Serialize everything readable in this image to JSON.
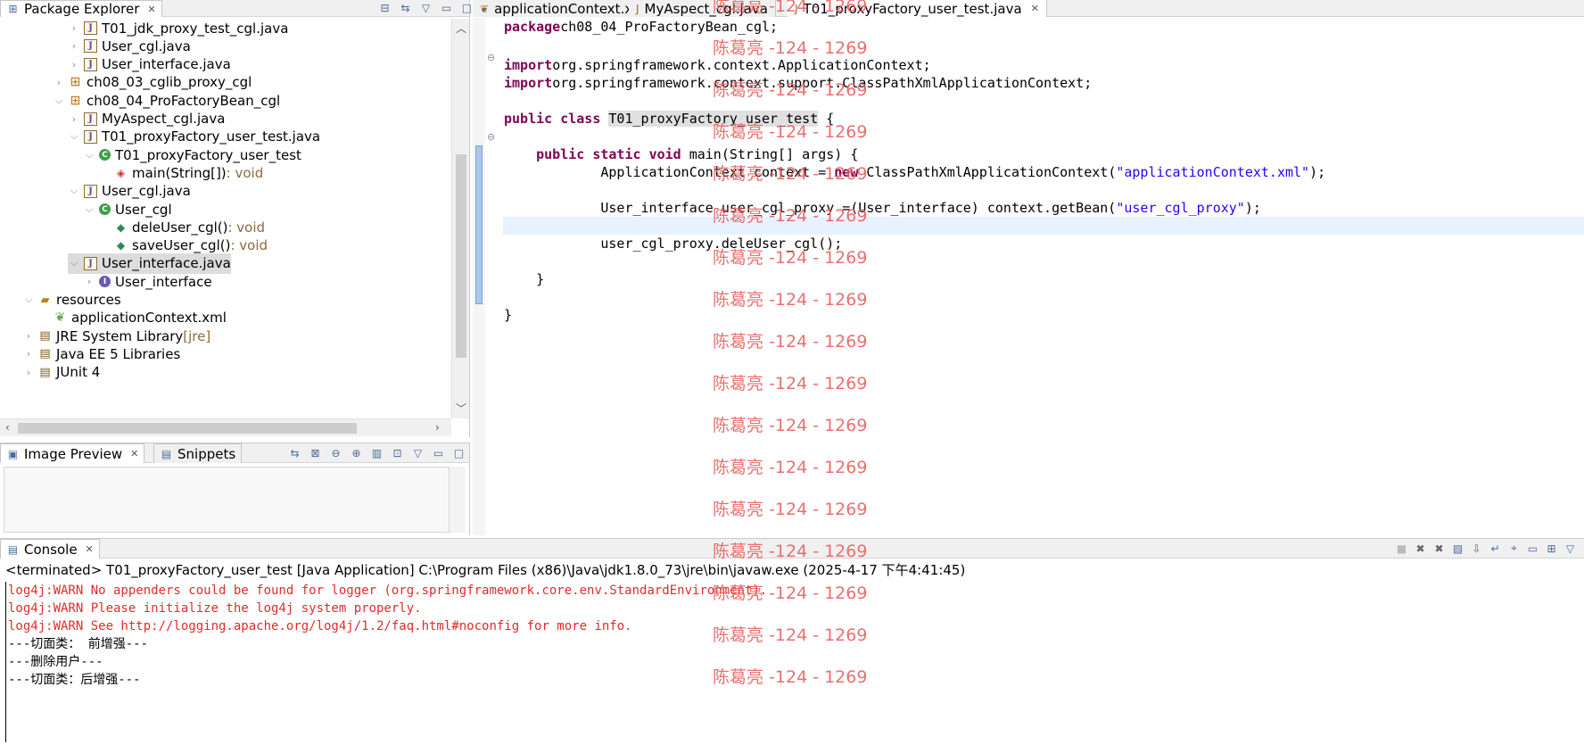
{
  "package_explorer": {
    "title": "Package Explorer",
    "tree": [
      {
        "label": "T01_jdk_proxy_test_cgl.java",
        "icon": "java-file-icon",
        "twisty": "collapsed",
        "indent": 4
      },
      {
        "label": "User_cgl.java",
        "icon": "java-file-icon",
        "twisty": "collapsed",
        "indent": 4
      },
      {
        "label": "User_interface.java",
        "icon": "java-file-icon",
        "twisty": "collapsed",
        "indent": 4
      },
      {
        "label": "ch08_03_cglib_proxy_cgl",
        "icon": "package-icon",
        "twisty": "collapsed",
        "indent": 3
      },
      {
        "label": "ch08_04_ProFactoryBean_cgl",
        "icon": "package-icon",
        "twisty": "expanded",
        "indent": 3
      },
      {
        "label": "MyAspect_cgl.java",
        "icon": "java-file-icon",
        "twisty": "collapsed",
        "indent": 4
      },
      {
        "label": "T01_proxyFactory_user_test.java",
        "icon": "java-file-icon",
        "twisty": "expanded",
        "indent": 4
      },
      {
        "label": "T01_proxyFactory_user_test",
        "icon": "class-icon",
        "twisty": "expanded",
        "indent": 5
      },
      {
        "label": "main(String[])",
        "type": " : void",
        "icon": "static-method-icon",
        "twisty": "none",
        "indent": 6
      },
      {
        "label": "User_cgl.java",
        "icon": "java-file-icon",
        "twisty": "expanded",
        "indent": 4
      },
      {
        "label": "User_cgl",
        "icon": "class-icon",
        "twisty": "expanded",
        "indent": 5
      },
      {
        "label": "deleUser_cgl()",
        "type": " : void",
        "icon": "method-icon",
        "twisty": "none",
        "indent": 6
      },
      {
        "label": "saveUser_cgl()",
        "type": " : void",
        "icon": "method-icon",
        "twisty": "none",
        "indent": 6
      },
      {
        "label": "User_interface.java",
        "icon": "java-file-icon",
        "twisty": "expanded",
        "indent": 4,
        "selected": true
      },
      {
        "label": "User_interface",
        "icon": "interface-icon",
        "twisty": "collapsed",
        "indent": 5
      },
      {
        "label": "resources",
        "icon": "folder-icon",
        "twisty": "expanded",
        "indent": 1
      },
      {
        "label": "applicationContext.xml",
        "icon": "xml-file-icon",
        "twisty": "none",
        "indent": 2
      },
      {
        "label": "JRE System Library",
        "decor": " [jre]",
        "icon": "library-icon",
        "twisty": "collapsed",
        "indent": 1
      },
      {
        "label": "Java EE 5 Libraries",
        "icon": "library-icon",
        "twisty": "collapsed",
        "indent": 1
      },
      {
        "label": "JUnit 4",
        "icon": "library-icon",
        "twisty": "collapsed",
        "indent": 1
      }
    ]
  },
  "image_preview": {
    "title": "Image Preview",
    "tab2": "Snippets"
  },
  "editor": {
    "tabs": [
      {
        "label": "applicationContext.xml",
        "active": false
      },
      {
        "label": "MyAspect_cgl.java",
        "active": false
      },
      {
        "label": "T01_proxyFactory_user_test.java",
        "active": true
      }
    ],
    "code": [
      [
        [
          "kw",
          "package"
        ],
        [
          "",
          "ch08_04_ProFactoryBean_cgl;"
        ]
      ],
      [],
      [
        [
          "kw",
          "import"
        ],
        [
          "",
          "org.springframework.context.ApplicationContext;"
        ]
      ],
      [
        [
          "kw",
          "import"
        ],
        [
          "",
          "org.springframework.context.support.ClassPathXmlApplicationContext;"
        ]
      ],
      [],
      [
        [
          "kw",
          "public"
        ],
        [
          "",
          " "
        ],
        [
          "kw",
          "class"
        ],
        [
          "",
          " "
        ],
        [
          "hl",
          "T01_proxyFactory_user_test"
        ],
        [
          "",
          " {"
        ]
      ],
      [],
      [
        [
          "",
          "    "
        ],
        [
          "kw",
          "public"
        ],
        [
          "",
          " "
        ],
        [
          "kw",
          "static"
        ],
        [
          "",
          " "
        ],
        [
          "kw",
          "void"
        ],
        [
          "",
          " main(String[] args) {"
        ]
      ],
      [
        [
          "",
          "            ApplicationContext context = "
        ],
        [
          "kw",
          "new"
        ],
        [
          "",
          " ClassPathXmlApplicationContext("
        ],
        [
          "str",
          "\"applicationContext.xml\""
        ],
        [
          "",
          ");"
        ]
      ],
      [],
      [
        [
          "",
          "            User_interface user_cgl_proxy =(User_interface) context.getBean("
        ],
        [
          "str",
          "\"user_cgl_proxy\""
        ],
        [
          "",
          ");"
        ]
      ],
      [],
      [
        [
          "",
          "            user_cgl_proxy.deleUser_cgl();"
        ]
      ],
      [],
      [
        [
          "",
          "    }"
        ]
      ],
      [],
      [
        [
          "",
          "}"
        ]
      ]
    ],
    "current_line": 11
  },
  "console": {
    "title": "Console",
    "description": "<terminated> T01_proxyFactory_user_test [Java Application] C:\\Program Files (x86)\\Java\\jdk1.8.0_73\\jre\\bin\\javaw.exe (2025-4-17 下午4:41:45)",
    "lines": [
      {
        "text": "log4j:WARN No appenders could be found for logger (org.springframework.core.env.StandardEnvironment).",
        "kind": "err"
      },
      {
        "text": "log4j:WARN Please initialize the log4j system properly.",
        "kind": "err"
      },
      {
        "text": "log4j:WARN See http://logging.apache.org/log4j/1.2/faq.html#noconfig for more info.",
        "kind": "err"
      },
      {
        "text": "---切面类： 前增强---",
        "kind": "out"
      },
      {
        "text": "---删除用户---",
        "kind": "out"
      },
      {
        "text": "---切面类：后增强---",
        "kind": "out"
      }
    ]
  },
  "watermark": {
    "text": "陈葛亮 -124 - 1269",
    "count": 17
  },
  "colors": {
    "keyword": "#7f0055",
    "string": "#2a00ff",
    "console_error": "#e12b2b",
    "watermark": "#e86060"
  }
}
